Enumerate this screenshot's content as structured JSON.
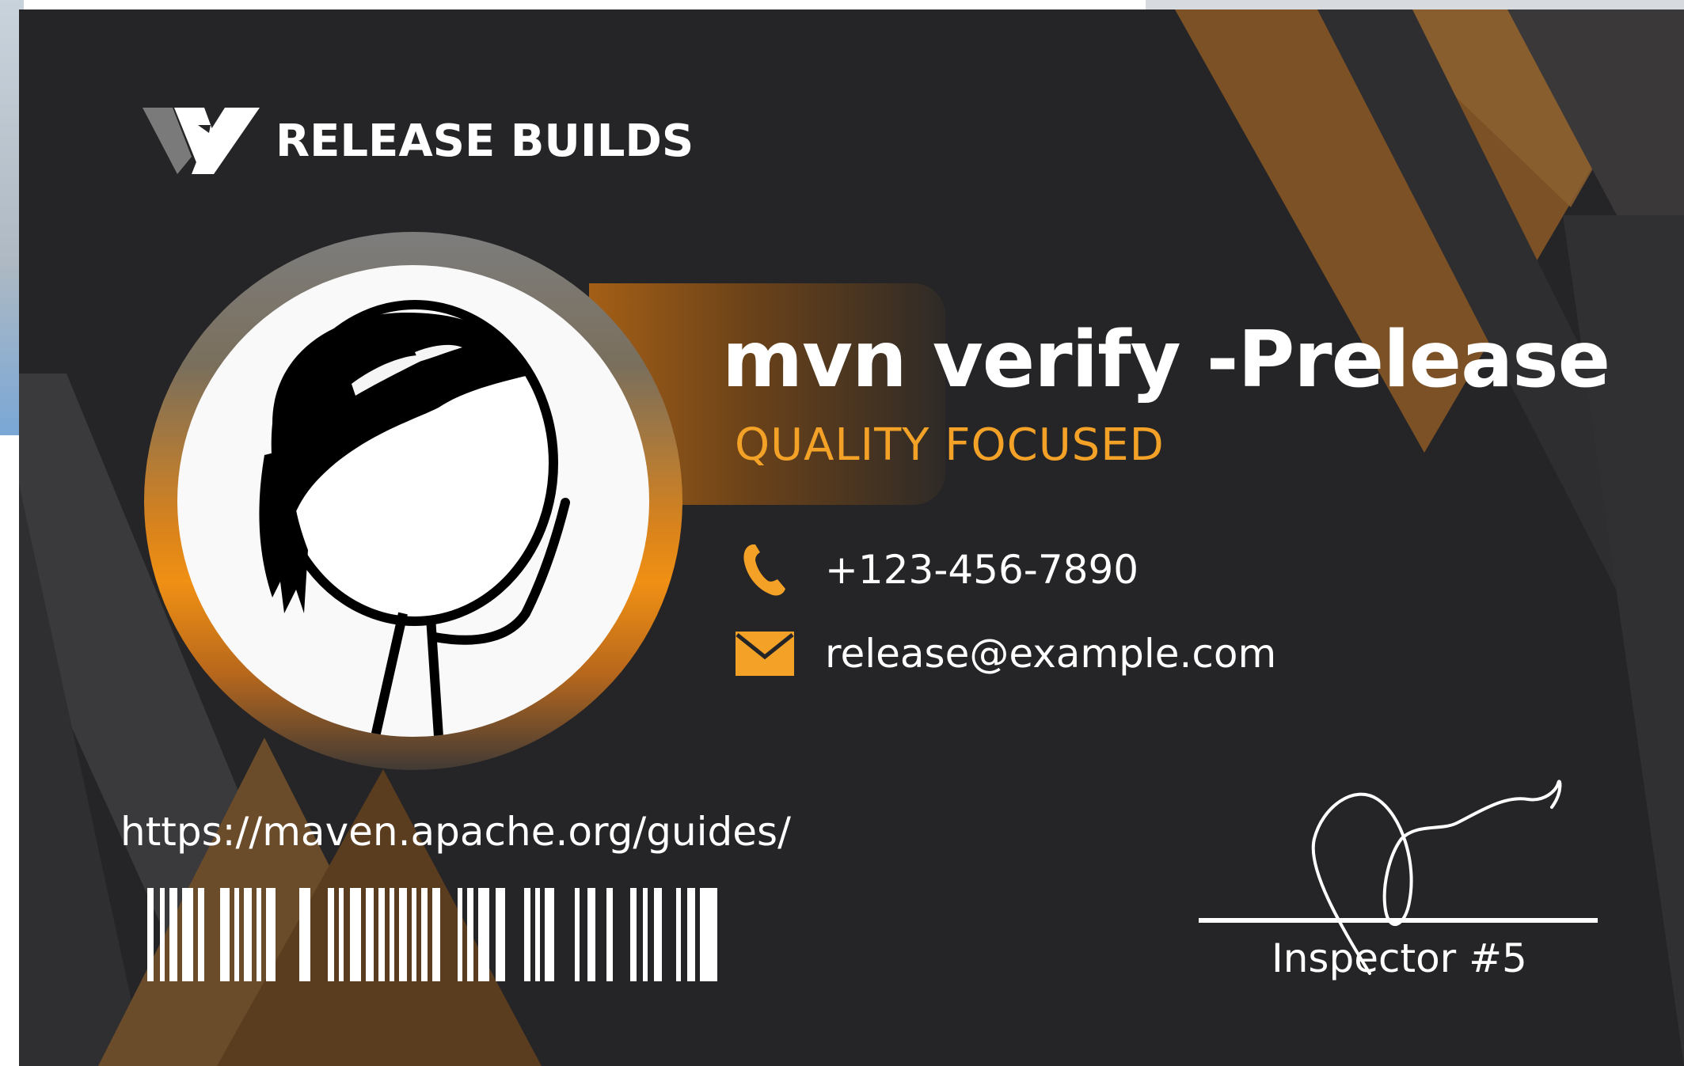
{
  "card": {
    "brand": "RELEASE BUILDS",
    "title": "mvn verify -Prelease",
    "subtitle": "QUALITY FOCUSED",
    "phone": "+123-456-7890",
    "email": "release@example.com",
    "url": "https://maven.apache.org/guides/",
    "signature_label": "Inspector #5"
  },
  "icons": {
    "logo": "w-logo-icon",
    "phone": "phone-icon",
    "email": "envelope-icon",
    "barcode": "barcode",
    "avatar": "stick-figure-avatar"
  },
  "colors": {
    "card_background": "#252427",
    "accent_orange": "#f3a227",
    "bronze": "#7b5125",
    "text": "#ffffff"
  }
}
